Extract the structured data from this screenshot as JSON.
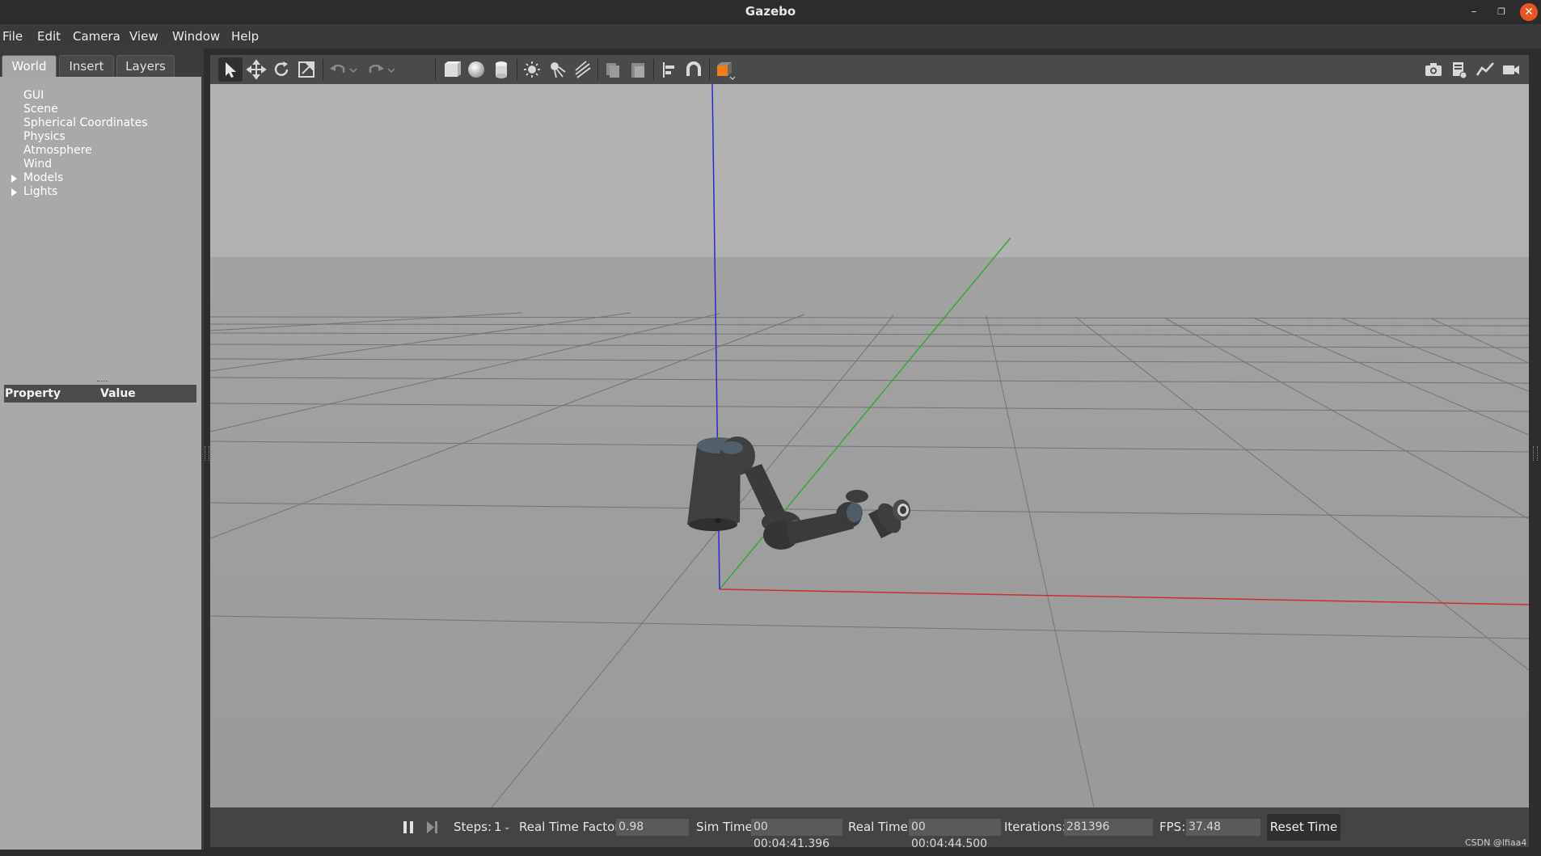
{
  "window": {
    "title": "Gazebo",
    "minimize_glyph": "–",
    "maximize_glyph": "❐",
    "close_glyph": "✕"
  },
  "menubar": {
    "items": [
      "File",
      "Edit",
      "Camera",
      "View",
      "Window",
      "Help"
    ]
  },
  "left_panel": {
    "tabs": [
      {
        "label": "World",
        "active": true
      },
      {
        "label": "Insert",
        "active": false
      },
      {
        "label": "Layers",
        "active": false
      }
    ],
    "tree": [
      {
        "label": "GUI",
        "expandable": false
      },
      {
        "label": "Scene",
        "expandable": false
      },
      {
        "label": "Spherical Coordinates",
        "expandable": false
      },
      {
        "label": "Physics",
        "expandable": false
      },
      {
        "label": "Atmosphere",
        "expandable": false
      },
      {
        "label": "Wind",
        "expandable": false
      },
      {
        "label": "Models",
        "expandable": true
      },
      {
        "label": "Lights",
        "expandable": true
      }
    ],
    "property_header": {
      "property": "Property",
      "value": "Value"
    }
  },
  "toolbar": {
    "left_tools": [
      "select-arrow-icon",
      "translate-icon",
      "rotate-icon",
      "scale-icon",
      "undo-icon",
      "undo-dropdown-icon",
      "redo-icon",
      "redo-dropdown-icon",
      "box-icon",
      "sphere-icon",
      "cylinder-icon",
      "point-light-icon",
      "spot-light-icon",
      "directional-light-icon",
      "copy-icon",
      "paste-icon",
      "align-icon",
      "snap-icon",
      "view-angle-icon"
    ],
    "right_tools": [
      "screenshot-icon",
      "log-icon",
      "plot-icon",
      "video-icon"
    ],
    "active_tool": "select-arrow-icon"
  },
  "bottom_bar": {
    "steps_label": "Steps:",
    "steps_value": "1",
    "rtf_label": "Real Time Factor:",
    "rtf_value": "0.98",
    "sim_time_label": "Sim Time:",
    "sim_time_value": "00 00:04:41.396",
    "real_time_label": "Real Time:",
    "real_time_value": "00 00:04:44.500",
    "iterations_label": "Iterations:",
    "iterations_value": "281396",
    "fps_label": "FPS:",
    "fps_value": "37.48",
    "reset_button": "Reset Time"
  },
  "watermark": "CSDN @lfiaa4",
  "colors": {
    "sky": "#b2b2b2",
    "ground": "#9d9d9d",
    "axis_x": "#d03030",
    "axis_y": "#33aa33",
    "axis_z": "#2a2ad0",
    "close_button": "#e95420"
  }
}
